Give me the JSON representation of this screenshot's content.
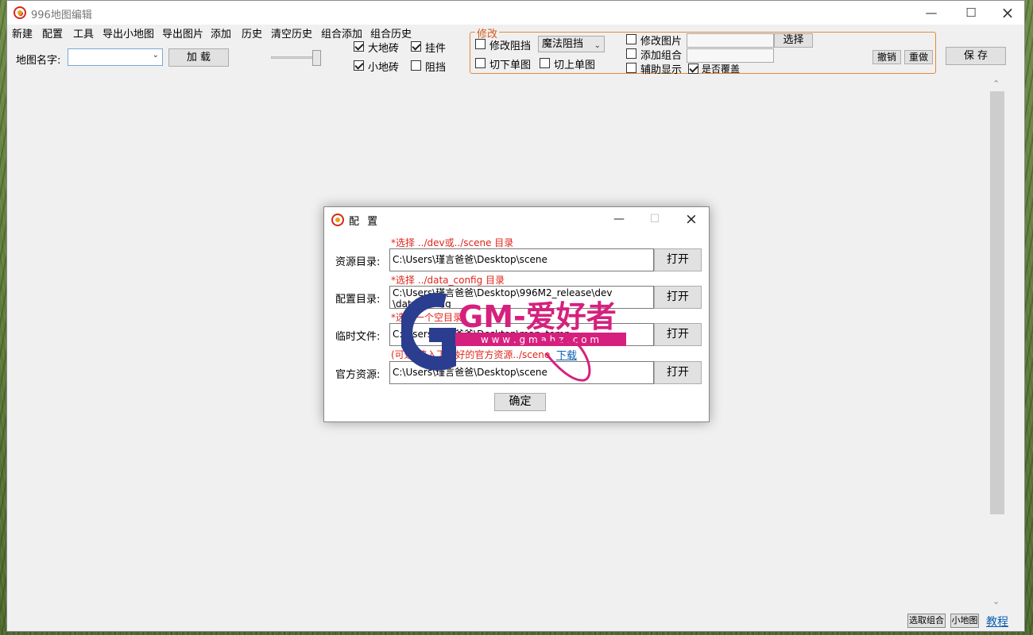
{
  "window": {
    "title": "996地图编辑"
  },
  "menu": {
    "items": [
      "新建",
      "配置",
      "工具",
      "导出小地图",
      "导出图片",
      "添加",
      "历史",
      "清空历史",
      "组合添加",
      "组合历史"
    ]
  },
  "toolbar": {
    "map_name_label": "地图名字:",
    "map_name_value": "",
    "load_button": "加 载",
    "checkboxes": [
      {
        "label": "大地砖",
        "checked": true
      },
      {
        "label": "挂件",
        "checked": true
      },
      {
        "label": "小地砖",
        "checked": true
      },
      {
        "label": "阻挡",
        "checked": false
      }
    ]
  },
  "modify_group": {
    "title": "修改",
    "modify_block_label": "修改阻挡",
    "modify_block_checked": false,
    "block_type_value": "魔法阻挡",
    "cut_down_label": "切下单图",
    "cut_down_checked": false,
    "cut_up_label": "切上单图",
    "cut_up_checked": false,
    "modify_image_label": "修改图片",
    "modify_image_checked": false,
    "select_button": "选择",
    "add_combo_label": "添加组合",
    "add_combo_checked": false,
    "aux_display_label": "辅助显示",
    "aux_display_checked": false,
    "overwrite_label": "是否覆盖",
    "overwrite_checked": true,
    "undo_button": "撤销",
    "redo_button": "重做"
  },
  "save_button": "保 存",
  "bottom": {
    "select_combo_button": "选取组合",
    "minimap_button": "小地图",
    "tutorial_link": "教程"
  },
  "dialog": {
    "title": "配 置",
    "rows": [
      {
        "label": "资源目录:",
        "hint": "*选择 ../dev或../scene 目录",
        "value": "C:\\Users\\瑾言爸爸\\Desktop\\scene",
        "button": "打开"
      },
      {
        "label": "配置目录:",
        "hint": "*选择 ../data_config 目录",
        "value": "C:\\Users\\瑾言爸爸\\Desktop\\996M2_release\\dev\n\\data_config",
        "button": "打开"
      },
      {
        "label": "临时文件:",
        "hint": "*选择一个空目录",
        "value": "C:\\Users\\瑾言爸爸\\Desktop\\map_temp",
        "button": "打开"
      },
      {
        "label": "官方资源:",
        "hint": "(可选)填入下载好的官方资源../scene",
        "value": "C:\\Users\\瑾言爸爸\\Desktop\\scene",
        "button": "打开"
      }
    ],
    "download_link": "下载",
    "ok_button": "确定"
  },
  "watermark": {
    "text": "GM-爱好者",
    "url": "w w w . g m a h z . c o m"
  },
  "colors": {
    "accent_orange": "#e08a3a",
    "hint_red": "#e0241a",
    "link_blue": "#0b5fb3"
  }
}
